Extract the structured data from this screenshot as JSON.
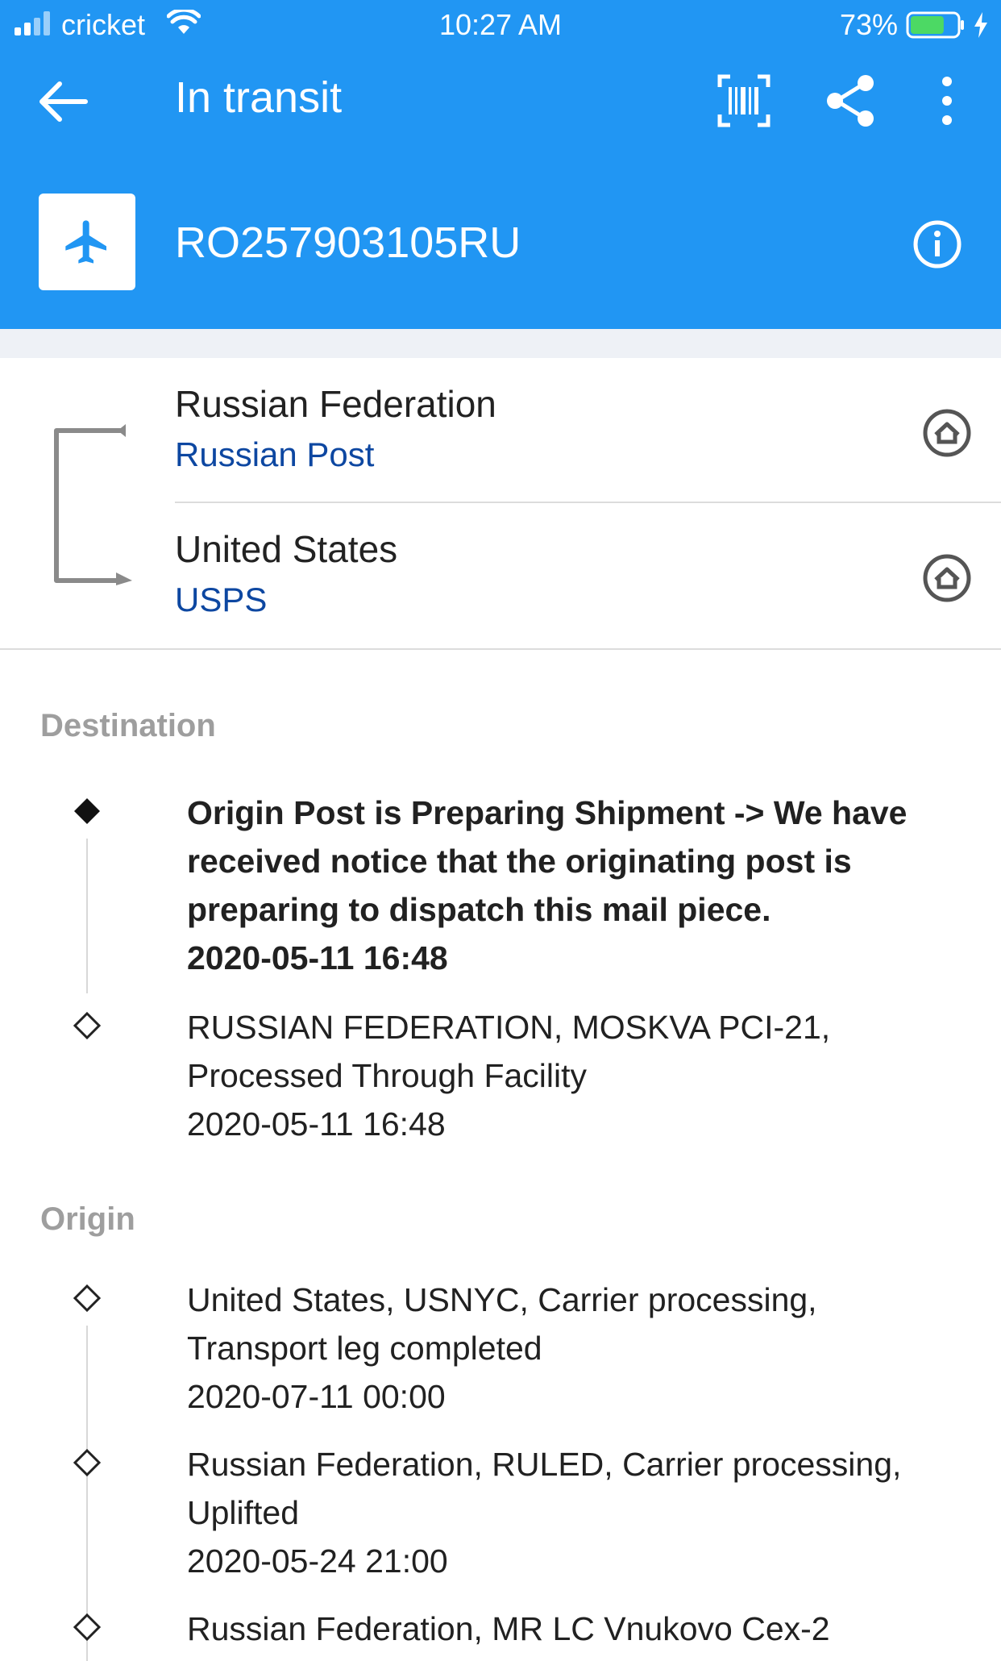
{
  "status_bar": {
    "carrier": "cricket",
    "time": "10:27 AM",
    "battery_percent": "73%",
    "battery_level": 0.73
  },
  "toolbar": {
    "title": "In transit",
    "back_icon": "arrow-left-icon",
    "scan_icon": "barcode-scan-icon",
    "share_icon": "share-icon",
    "more_icon": "more-vert-icon"
  },
  "package": {
    "icon": "airplane-icon",
    "tracking_number": "RO257903105RU",
    "info_icon": "info-icon"
  },
  "route": {
    "from": {
      "country": "Russian Federation",
      "carrier": "Russian Post"
    },
    "to": {
      "country": "United States",
      "carrier": "USPS"
    }
  },
  "destination": {
    "label": "Destination",
    "events": [
      {
        "description": "Origin Post is Preparing Shipment -> We have received notice that the originating post is preparing to dispatch this mail piece.",
        "timestamp": "2020-05-11 16:48"
      },
      {
        "description": "RUSSIAN FEDERATION, MOSKVA PCI-21, Processed Through Facility",
        "timestamp": "2020-05-11 16:48"
      }
    ]
  },
  "origin": {
    "label": "Origin",
    "events": [
      {
        "description": "United States, USNYC, Carrier processing, Transport leg completed",
        "timestamp": "2020-07-11 00:00"
      },
      {
        "description": "Russian Federation, RULED, Carrier processing, Uplifted",
        "timestamp": "2020-05-24 21:00"
      },
      {
        "description": "Russian Federation, MR LC Vnukovo Cex-2",
        "timestamp": ""
      }
    ]
  },
  "colors": {
    "primary": "#2196f3",
    "carrier_link": "#0d47a1",
    "section_label": "#9e9e9e"
  }
}
